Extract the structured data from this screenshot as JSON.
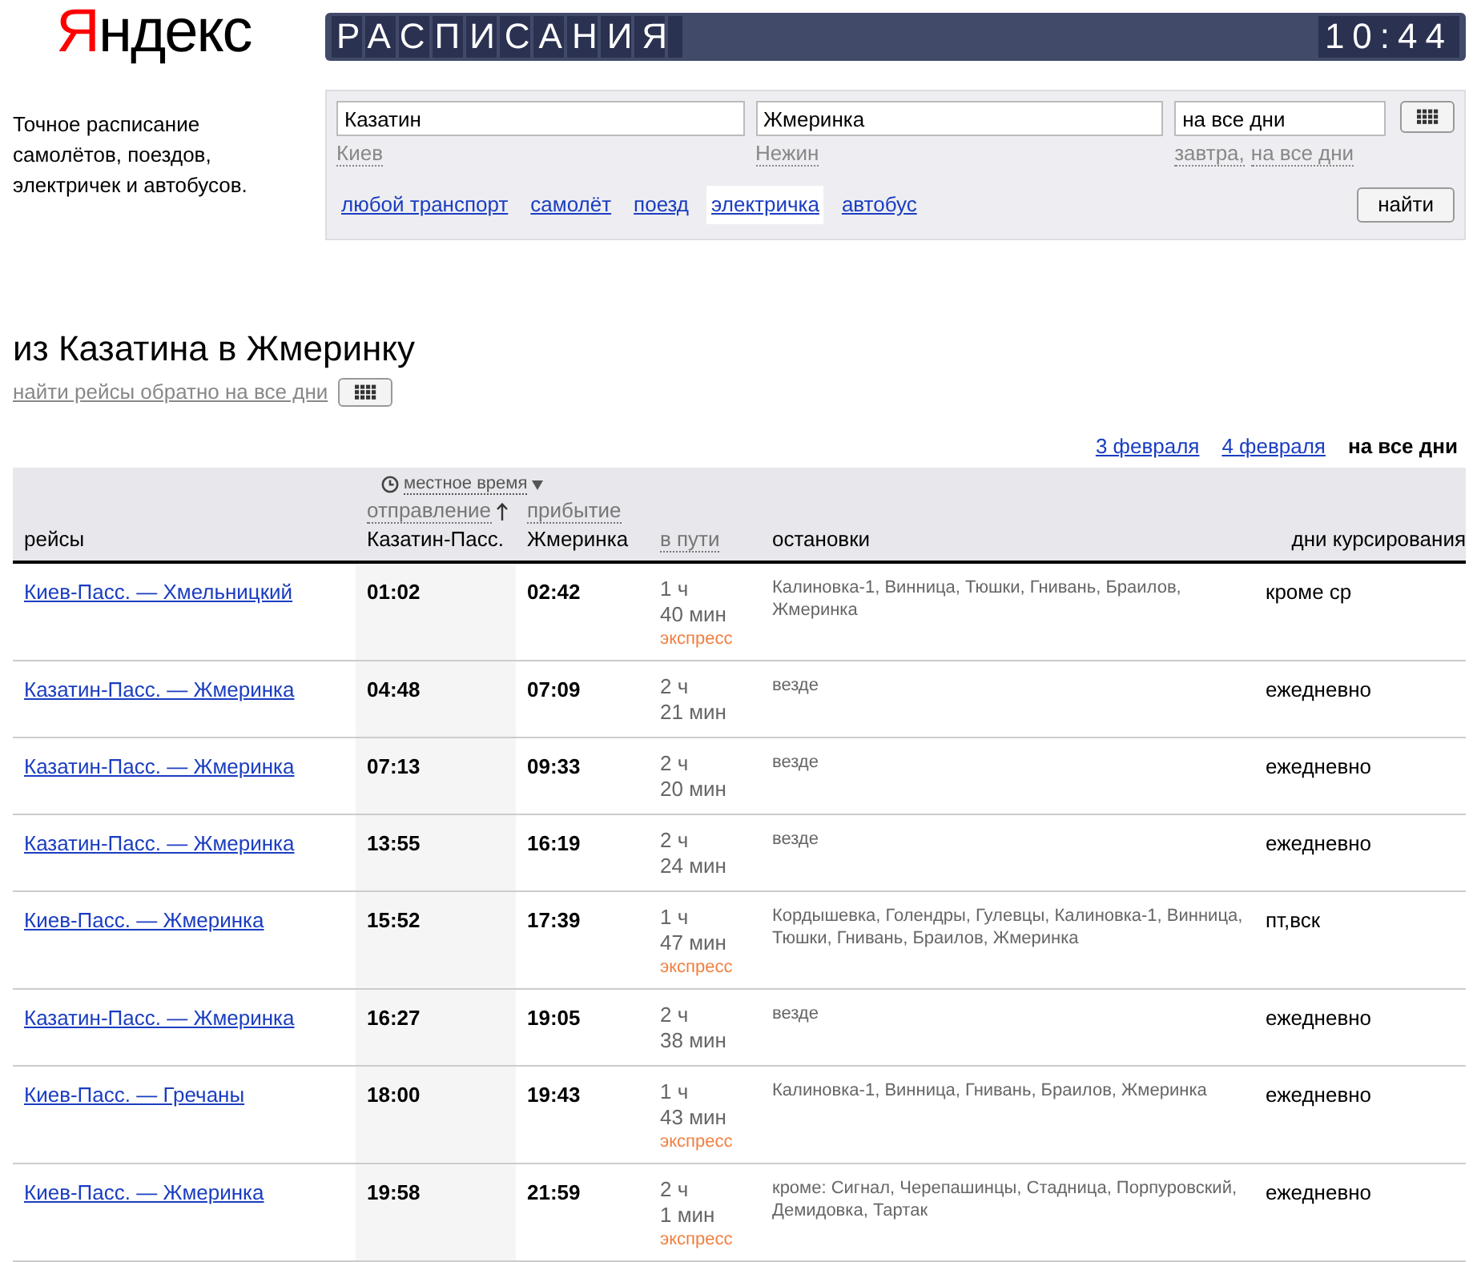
{
  "logo": "Яндекс",
  "board": {
    "title": "РАСПИСАНИЯ",
    "clock": "10:44"
  },
  "tagline": "Точное расписание самолётов, поездов, электричек и автобусов.",
  "search": {
    "from": {
      "value": "Казатин",
      "hint": "Киев"
    },
    "to": {
      "value": "Жмеринка",
      "hint": "Нежин"
    },
    "date": {
      "value": "на все дни",
      "hints": [
        "завтра,",
        "на все дни"
      ]
    },
    "transport": [
      {
        "label": "любой транспорт",
        "selected": false
      },
      {
        "label": "самолёт",
        "selected": false
      },
      {
        "label": "поезд",
        "selected": false
      },
      {
        "label": "электричка",
        "selected": true
      },
      {
        "label": "автобус",
        "selected": false
      }
    ],
    "submit": "найти"
  },
  "heading": "из Казатина в Жмеринку",
  "return_link": "найти рейсы обратно на все дни",
  "dates": [
    {
      "label": "3 февраля",
      "selected": false
    },
    {
      "label": "4 февраля",
      "selected": false
    },
    {
      "label": "на все дни",
      "selected": true
    }
  ],
  "table": {
    "time_zone": "местное время",
    "columns": {
      "route": "рейсы",
      "departure": "отправление",
      "departure_station": "Казатин-Пасс.",
      "arrival": "прибытие",
      "arrival_station": "Жмеринка",
      "duration": "в пути",
      "stops": "остановки",
      "days": "дни курсирования"
    },
    "rows": [
      {
        "route": "Киев-Пасс. — Хмельницкий",
        "departure": "01:02",
        "arrival": "02:42",
        "duration": [
          "1 ч",
          "40 мин"
        ],
        "express": "экспресс",
        "stops": "Калиновка-1, Винница, Тюшки, Гнивань, Браилов, Жмеринка",
        "days": "кроме ср"
      },
      {
        "route": "Казатин-Пасс. — Жмеринка",
        "departure": "04:48",
        "arrival": "07:09",
        "duration": [
          "2 ч",
          "21 мин"
        ],
        "stops": "везде",
        "days": "ежедневно"
      },
      {
        "route": "Казатин-Пасс. — Жмеринка",
        "departure": "07:13",
        "arrival": "09:33",
        "duration": [
          "2 ч",
          "20 мин"
        ],
        "stops": "везде",
        "days": "ежедневно"
      },
      {
        "route": "Казатин-Пасс. — Жмеринка",
        "departure": "13:55",
        "arrival": "16:19",
        "duration": [
          "2 ч",
          "24 мин"
        ],
        "stops": "везде",
        "days": "ежедневно"
      },
      {
        "route": "Киев-Пасс. — Жмеринка",
        "departure": "15:52",
        "arrival": "17:39",
        "duration": [
          "1 ч",
          "47 мин"
        ],
        "express": "экспресс",
        "stops": "Кордышевка, Голендры, Гулевцы, Калиновка-1, Винница, Тюшки, Гнивань, Браилов, Жмеринка",
        "days": "пт,вск"
      },
      {
        "route": "Казатин-Пасс. — Жмеринка",
        "departure": "16:27",
        "arrival": "19:05",
        "duration": [
          "2 ч",
          "38 мин"
        ],
        "stops": "везде",
        "days": "ежедневно"
      },
      {
        "route": "Киев-Пасс. — Гречаны",
        "departure": "18:00",
        "arrival": "19:43",
        "duration": [
          "1 ч",
          "43 мин"
        ],
        "express": "экспресс",
        "stops": "Калиновка-1, Винница, Гнивань, Браилов, Жмеринка",
        "days": "ежедневно"
      },
      {
        "route": "Киев-Пасс. — Жмеринка",
        "departure": "19:58",
        "arrival": "21:59",
        "duration": [
          "2 ч",
          "1 мин"
        ],
        "express": "экспресс",
        "stops": "кроме: Сигнал, Черепашинцы, Стадница, Порпуровский, Демидовка, Тартак",
        "days": "ежедневно"
      }
    ]
  }
}
